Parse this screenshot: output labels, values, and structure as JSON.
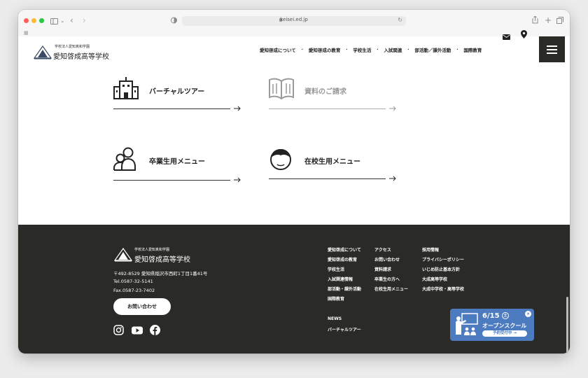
{
  "browser": {
    "url": "keisei.ed.jp"
  },
  "header": {
    "logo_sub": "学校法人愛知真和学園",
    "logo_main": "愛知啓成高等学校",
    "nav": [
      "愛知啓成について",
      "愛知啓成の教育",
      "学校生活",
      "入試関連",
      "部活動／課外活動",
      "国際教育"
    ]
  },
  "cards": {
    "virtual_tour": "バーチャルツアー",
    "brochure": "資料のご請求",
    "alumni_menu": "卒業生用メニュー",
    "student_menu": "在校生用メニュー"
  },
  "footer": {
    "logo_sub": "学校法人愛知真和学園",
    "logo_main": "愛知啓成高等学校",
    "address": "〒492-8529 愛知県稲沢市西町1丁目1番41号",
    "tel": "Tel.0587-32-5141",
    "fax": "Fax.0587-23-7402",
    "contact_button": "お問い合わせ",
    "col1": [
      "愛知啓成について",
      "愛知啓成の教育",
      "学校生活",
      "入試関連情報",
      "部活動・課外活動",
      "国際教育"
    ],
    "col2": [
      "アクセス",
      "お問い合わせ",
      "資料請求",
      "卒業生の方へ",
      "在校生用メニュー"
    ],
    "col3": [
      "採用情報",
      "プライバシーポリシー",
      "いじめ防止基本方針",
      "大成高等学校",
      "大成中学校・高等学校"
    ],
    "news": "NEWS",
    "virtual_tour": "バーチャルツアー"
  },
  "banner": {
    "date": "6/15",
    "day": "土",
    "title": "オープンスクール",
    "pill": "予約受付中 →"
  }
}
